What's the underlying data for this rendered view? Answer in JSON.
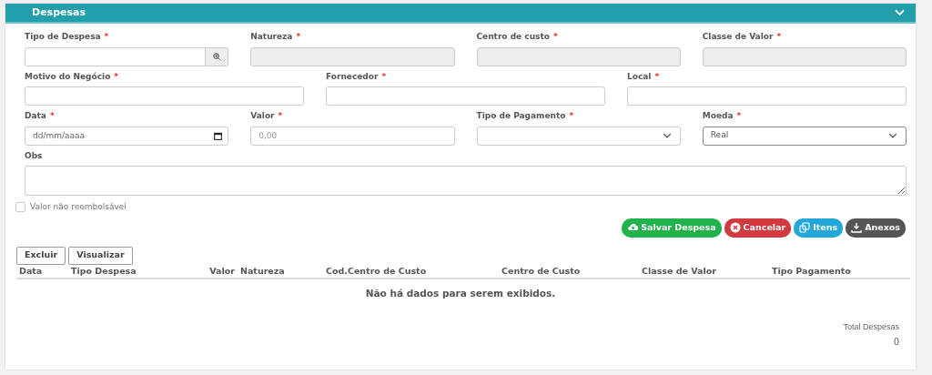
{
  "panel": {
    "title": "Despesas",
    "expanded": true
  },
  "form_rows": [
    {
      "fields": [
        {
          "label": "Tipo de Despesa",
          "required_mark": "*",
          "kind": "lookup",
          "disabled": false
        },
        {
          "label": "Natureza",
          "required_mark": "*",
          "kind": "text",
          "disabled": true
        },
        {
          "label": "Centro de custo",
          "required_mark": "*",
          "kind": "text",
          "disabled": true
        },
        {
          "label": "Classe de Valor",
          "required_mark": "*",
          "kind": "text",
          "disabled": true
        }
      ]
    },
    {
      "fields": [
        {
          "label": "Motivo do Negócio",
          "required_mark": "*",
          "kind": "text",
          "disabled": false
        },
        {
          "label": "Fornecedor",
          "required_mark": "*",
          "kind": "text",
          "disabled": false
        },
        {
          "label": "Local",
          "required_mark": "*",
          "kind": "text",
          "disabled": false
        }
      ]
    },
    {
      "fields": [
        {
          "label": "Data",
          "required_mark": "*",
          "kind": "date",
          "disabled": false,
          "placeholder": "dd/mm/aaaa"
        },
        {
          "label": "Valor",
          "required_mark": "*",
          "kind": "text",
          "disabled": false,
          "placeholder": "0,00"
        },
        {
          "label": "Tipo de Pagamento",
          "required_mark": "*",
          "kind": "select",
          "disabled": false
        },
        {
          "label": "Moeda",
          "required_mark": "*",
          "kind": "select",
          "disabled": false,
          "value": "Real"
        }
      ]
    },
    {
      "fields": [
        {
          "label": "Obs",
          "kind": "textarea",
          "disabled": false
        }
      ]
    }
  ],
  "checkbox": {
    "label": "Valor não reembolsável",
    "checked": false
  },
  "actions": [
    {
      "label": "Salvar Despesa",
      "kind": "save"
    },
    {
      "label": "Cancelar",
      "kind": "cancel"
    },
    {
      "label": "Itens",
      "kind": "items"
    },
    {
      "label": "Anexos",
      "kind": "attachments"
    }
  ],
  "table_buttons": [
    "Excluir",
    "Visualizar"
  ],
  "table": {
    "columns": [
      "Data",
      "Tipo Despesa",
      "Valor",
      "Natureza",
      "Cod.Centro de Custo",
      "Centro de Custo",
      "Classe de Valor",
      "Tipo Pagamento"
    ],
    "empty_message": "Não há dados para serem exibidos."
  },
  "total": {
    "label": "Total Despesas",
    "value": "0"
  }
}
